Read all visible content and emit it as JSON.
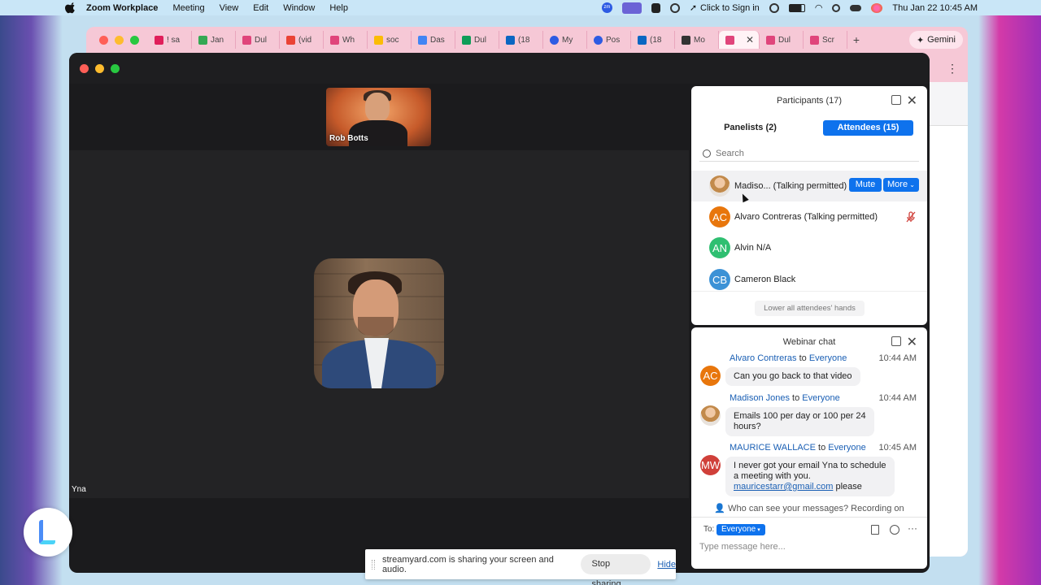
{
  "menubar": {
    "app_name": "Zoom Workplace",
    "menus": [
      "Meeting",
      "View",
      "Edit",
      "Window",
      "Help"
    ],
    "sign_in": "Click to Sign in",
    "datetime": "Thu Jan 22  10:45 AM"
  },
  "browser": {
    "tabs": [
      {
        "label": "! sa",
        "color": "#e01e5a"
      },
      {
        "label": "Jan",
        "color": "#34a853"
      },
      {
        "label": "Dul",
        "color": "#e0457b"
      },
      {
        "label": "(vid",
        "color": "#ea4335"
      },
      {
        "label": "Wh",
        "color": "#e0457b"
      },
      {
        "label": "soc",
        "color": "#fbbc05"
      },
      {
        "label": "Das",
        "color": "#4285f4"
      },
      {
        "label": "Dul",
        "color": "#0f9d58"
      },
      {
        "label": "(18",
        "color": "#0a66c2"
      },
      {
        "label": "My",
        "color": "#2d5be3"
      },
      {
        "label": "Pos",
        "color": "#2d5be3"
      },
      {
        "label": "(18",
        "color": "#0a66c2"
      },
      {
        "label": "Mo",
        "color": "#333333"
      },
      {
        "label": "",
        "color": "#e0457b"
      },
      {
        "label": "Dul",
        "color": "#e0457b"
      },
      {
        "label": "Scr",
        "color": "#e0457b"
      }
    ],
    "new_tab": "+",
    "gemini_label": "Gemini"
  },
  "zoom": {
    "thumbnail_name": "Rob Botts",
    "speaker_name": "Yna"
  },
  "participants": {
    "title": "Participants (17)",
    "tab_panelists": "Panelists (2)",
    "tab_attendees": "Attendees (15)",
    "search_placeholder": "Search",
    "rows": [
      {
        "initials": "",
        "name": "Madiso...  (Talking permitted)",
        "color": "",
        "photo": true
      },
      {
        "initials": "AC",
        "name": "Alvaro Contreras (Talking permitted)",
        "color": "#e8760c"
      },
      {
        "initials": "AN",
        "name": "Alvin N/A",
        "color": "#2fbf71"
      },
      {
        "initials": "CB",
        "name": "Cameron Black",
        "color": "#3c92d6"
      }
    ],
    "mute_label": "Mute",
    "more_label": "More",
    "lower_hands_label": "Lower all attendees' hands"
  },
  "chat": {
    "title": "Webinar chat",
    "messages": [
      {
        "sender": "Alvaro Contreras",
        "to_word": " to ",
        "recipient": "Everyone",
        "time": "10:44 AM",
        "initials": "AC",
        "color": "#e8760c",
        "text": "Can you go back to that video"
      },
      {
        "sender": "Madison Jones",
        "to_word": " to ",
        "recipient": "Everyone",
        "time": "10:44 AM",
        "initials": "",
        "color": "",
        "text_line1": "Emails 100 per day or 100 per 24",
        "text_line2": "hours?"
      },
      {
        "sender": "MAURICE WALLACE",
        "to_word": " to ",
        "recipient": "Everyone",
        "time": "10:45 AM",
        "initials": "MW",
        "color": "#d0403a",
        "text_line1": "I never got your email Yna to schedule",
        "text_line2": "a meeting with you.",
        "link": "mauricestarr@gmail.com",
        "after_link": " please"
      }
    ],
    "visibility_note": "Who can see your messages? Recording on",
    "to_label": "To:",
    "to_value": "Everyone",
    "input_placeholder": "Type message here..."
  },
  "share_bar": {
    "message": "streamyard.com is sharing your screen and audio.",
    "stop_label": "Stop sharing",
    "hide_label": "Hide"
  }
}
